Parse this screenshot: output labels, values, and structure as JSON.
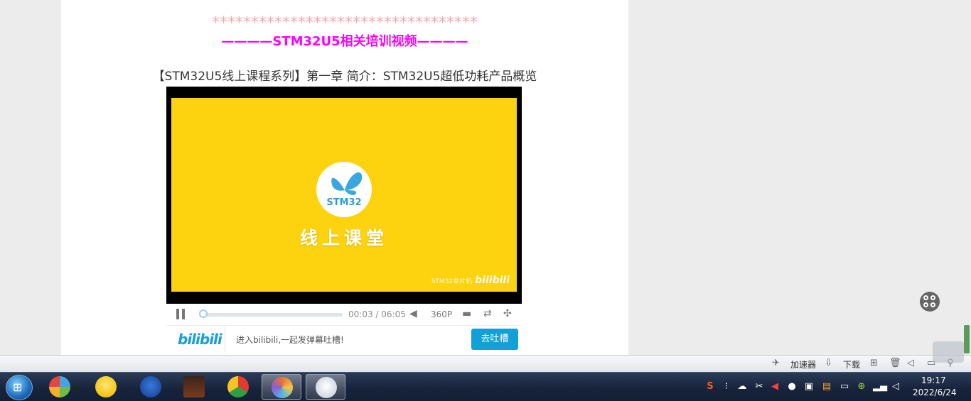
{
  "article": {
    "stars": "**********************************",
    "section_heading": "————STM32U5相关培训视频————",
    "video_title": "【STM32U5线上课程系列】第一章 简介：STM32U5超低功耗产品概览"
  },
  "player": {
    "logo_text": "STM32",
    "course_text": "线上课堂",
    "watermark_channel": "STM32单片机",
    "watermark_brand": "bilibili",
    "current_time": "00:03",
    "time_separator": "/",
    "duration": "06:05",
    "quality": "360P",
    "progress_fraction": 0.008,
    "danmaku_logo": "bilibili",
    "danmaku_prompt": "进入bilibili,一起发弹幕吐槽!",
    "danmaku_button": "去吐槽"
  },
  "browser_status_bar": {
    "accelerator": "加速器",
    "download": "下载"
  },
  "taskbar": {
    "time": "19:17",
    "date": "2022/6/24",
    "apps": [
      {
        "icon": "media-app-icon",
        "color": "#4aa3df"
      },
      {
        "icon": "chat-app-icon",
        "color": "#f3c614"
      },
      {
        "icon": "fs-app-icon",
        "color": "#1d4fa8"
      },
      {
        "icon": "photo-app-icon",
        "color": "#7a3b1f"
      },
      {
        "icon": "chrome-icon",
        "color": "#2f9e44"
      },
      {
        "icon": "browser-icon",
        "color": "#e8703a"
      },
      {
        "icon": "qq-app-icon",
        "color": "#eaeaea"
      }
    ]
  },
  "colors": {
    "heading_pink": "#ff00ff",
    "stars": "#f4a7b0",
    "video_bg": "#fdd20f",
    "button_blue": "#13a0d8"
  }
}
